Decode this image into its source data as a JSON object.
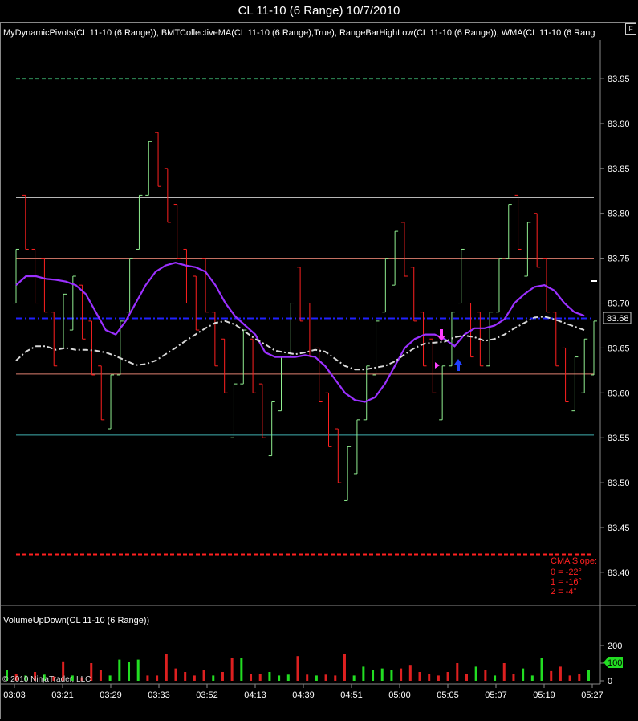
{
  "window": {
    "title": "CL 11-10 (6 Range)  10/7/2010",
    "float_button": "F"
  },
  "price_panel": {
    "label": "MyDynamicPivots(CL 11-10 (6 Range)), BMTCollectiveMA(CL 11-10 (6 Range),True), RangeBarHighLow(CL 11-10 (6 Range)), WMA(CL 11-10 (6 Rang",
    "y_ticks": [
      "83.95",
      "83.90",
      "83.85",
      "83.80",
      "83.75",
      "83.70",
      "83.65",
      "83.60",
      "83.55",
      "83.50",
      "83.45",
      "83.40"
    ],
    "last_price_label": "83.68",
    "cma_slope": {
      "title": "CMA Slope:",
      "lines": [
        "0 = -22°",
        "1 = -16°",
        "2 = -4°"
      ]
    }
  },
  "volume_panel": {
    "label": "VolumeUpDown(CL 11-10 (6 Range))",
    "y_ticks": [
      "200",
      "100",
      "0"
    ],
    "last_volume_label": "100"
  },
  "x_ticks": [
    "03:03",
    "03:21",
    "03:29",
    "03:33",
    "03:52",
    "04:13",
    "04:39",
    "04:51",
    "05:00",
    "05:05",
    "05:07",
    "05:19",
    "05:27"
  ],
  "copyright": "© 2010 NinjaTrader, LLC",
  "colors": {
    "up": "#90ee90",
    "down": "#ff2020",
    "wma": "#9b30ff",
    "cma": "#d8d8d8",
    "pivot_mid": "#2020ff",
    "volume_up": "#22dd22",
    "volume_down": "#dd2020"
  },
  "chart_data": {
    "type": "bar",
    "ohlc_bars": [
      {
        "hi": 83.76,
        "lo": 83.7,
        "o": 83.7,
        "c": 83.76
      },
      {
        "hi": 83.82,
        "lo": 83.76,
        "o": 83.82,
        "c": 83.76
      },
      {
        "hi": 83.76,
        "lo": 83.7,
        "o": 83.76,
        "c": 83.7
      },
      {
        "hi": 83.75,
        "lo": 83.69,
        "o": 83.75,
        "c": 83.69
      },
      {
        "hi": 83.69,
        "lo": 83.63,
        "o": 83.69,
        "c": 83.63
      },
      {
        "hi": 83.71,
        "lo": 83.65,
        "o": 83.65,
        "c": 83.71
      },
      {
        "hi": 83.73,
        "lo": 83.67,
        "o": 83.67,
        "c": 83.73
      },
      {
        "hi": 83.72,
        "lo": 83.66,
        "o": 83.72,
        "c": 83.66
      },
      {
        "hi": 83.68,
        "lo": 83.62,
        "o": 83.68,
        "c": 83.62
      },
      {
        "hi": 83.63,
        "lo": 83.57,
        "o": 83.63,
        "c": 83.57
      },
      {
        "hi": 83.62,
        "lo": 83.56,
        "o": 83.56,
        "c": 83.62
      },
      {
        "hi": 83.68,
        "lo": 83.62,
        "o": 83.62,
        "c": 83.68
      },
      {
        "hi": 83.75,
        "lo": 83.69,
        "o": 83.69,
        "c": 83.75
      },
      {
        "hi": 83.82,
        "lo": 83.76,
        "o": 83.76,
        "c": 83.82
      },
      {
        "hi": 83.88,
        "lo": 83.82,
        "o": 83.82,
        "c": 83.88
      },
      {
        "hi": 83.89,
        "lo": 83.83,
        "o": 83.89,
        "c": 83.83
      },
      {
        "hi": 83.85,
        "lo": 83.79,
        "o": 83.85,
        "c": 83.79
      },
      {
        "hi": 83.81,
        "lo": 83.75,
        "o": 83.81,
        "c": 83.75
      },
      {
        "hi": 83.76,
        "lo": 83.7,
        "o": 83.76,
        "c": 83.7
      },
      {
        "hi": 83.73,
        "lo": 83.67,
        "o": 83.73,
        "c": 83.67
      },
      {
        "hi": 83.75,
        "lo": 83.69,
        "o": 83.75,
        "c": 83.69
      },
      {
        "hi": 83.69,
        "lo": 83.63,
        "o": 83.69,
        "c": 83.63
      },
      {
        "hi": 83.66,
        "lo": 83.6,
        "o": 83.66,
        "c": 83.6
      },
      {
        "hi": 83.61,
        "lo": 83.55,
        "o": 83.55,
        "c": 83.61
      },
      {
        "hi": 83.67,
        "lo": 83.61,
        "o": 83.61,
        "c": 83.67
      },
      {
        "hi": 83.66,
        "lo": 83.6,
        "o": 83.66,
        "c": 83.6
      },
      {
        "hi": 83.61,
        "lo": 83.55,
        "o": 83.61,
        "c": 83.55
      },
      {
        "hi": 83.59,
        "lo": 83.53,
        "o": 83.53,
        "c": 83.59
      },
      {
        "hi": 83.64,
        "lo": 83.58,
        "o": 83.58,
        "c": 83.64
      },
      {
        "hi": 83.7,
        "lo": 83.64,
        "o": 83.64,
        "c": 83.7
      },
      {
        "hi": 83.74,
        "lo": 83.68,
        "o": 83.74,
        "c": 83.68
      },
      {
        "hi": 83.7,
        "lo": 83.64,
        "o": 83.7,
        "c": 83.64
      },
      {
        "hi": 83.65,
        "lo": 83.59,
        "o": 83.65,
        "c": 83.59
      },
      {
        "hi": 83.6,
        "lo": 83.54,
        "o": 83.6,
        "c": 83.54
      },
      {
        "hi": 83.56,
        "lo": 83.5,
        "o": 83.56,
        "c": 83.5
      },
      {
        "hi": 83.54,
        "lo": 83.48,
        "o": 83.48,
        "c": 83.54
      },
      {
        "hi": 83.57,
        "lo": 83.51,
        "o": 83.51,
        "c": 83.57
      },
      {
        "hi": 83.63,
        "lo": 83.57,
        "o": 83.57,
        "c": 83.63
      },
      {
        "hi": 83.68,
        "lo": 83.62,
        "o": 83.62,
        "c": 83.68
      },
      {
        "hi": 83.75,
        "lo": 83.69,
        "o": 83.69,
        "c": 83.75
      },
      {
        "hi": 83.78,
        "lo": 83.72,
        "o": 83.72,
        "c": 83.78
      },
      {
        "hi": 83.79,
        "lo": 83.73,
        "o": 83.79,
        "c": 83.73
      },
      {
        "hi": 83.74,
        "lo": 83.68,
        "o": 83.74,
        "c": 83.68
      },
      {
        "hi": 83.69,
        "lo": 83.63,
        "o": 83.69,
        "c": 83.63
      },
      {
        "hi": 83.66,
        "lo": 83.6,
        "o": 83.66,
        "c": 83.6
      },
      {
        "hi": 83.63,
        "lo": 83.57,
        "o": 83.57,
        "c": 83.63
      },
      {
        "hi": 83.69,
        "lo": 83.63,
        "o": 83.63,
        "c": 83.69
      },
      {
        "hi": 83.76,
        "lo": 83.7,
        "o": 83.7,
        "c": 83.76
      },
      {
        "hi": 83.7,
        "lo": 83.64,
        "o": 83.7,
        "c": 83.64
      },
      {
        "hi": 83.69,
        "lo": 83.63,
        "o": 83.69,
        "c": 83.63
      },
      {
        "hi": 83.69,
        "lo": 83.63,
        "o": 83.63,
        "c": 83.69
      },
      {
        "hi": 83.75,
        "lo": 83.69,
        "o": 83.69,
        "c": 83.75
      },
      {
        "hi": 83.81,
        "lo": 83.75,
        "o": 83.75,
        "c": 83.81
      },
      {
        "hi": 83.82,
        "lo": 83.76,
        "o": 83.82,
        "c": 83.76
      },
      {
        "hi": 83.79,
        "lo": 83.73,
        "o": 83.73,
        "c": 83.79
      },
      {
        "hi": 83.8,
        "lo": 83.74,
        "o": 83.8,
        "c": 83.74
      },
      {
        "hi": 83.75,
        "lo": 83.69,
        "o": 83.75,
        "c": 83.69
      },
      {
        "hi": 83.69,
        "lo": 83.63,
        "o": 83.69,
        "c": 83.63
      },
      {
        "hi": 83.65,
        "lo": 83.59,
        "o": 83.65,
        "c": 83.59
      },
      {
        "hi": 83.64,
        "lo": 83.58,
        "o": 83.58,
        "c": 83.64
      },
      {
        "hi": 83.66,
        "lo": 83.6,
        "o": 83.6,
        "c": 83.66
      },
      {
        "hi": 83.68,
        "lo": 83.62,
        "o": 83.62,
        "c": 83.68
      }
    ],
    "pivot_levels": [
      {
        "value": 83.95,
        "style": "dash",
        "color": "#2e8b57"
      },
      {
        "value": 83.818,
        "style": "solid",
        "color": "#d0d0d0"
      },
      {
        "value": 83.75,
        "style": "solid",
        "color": "#e08070"
      },
      {
        "value": 83.683,
        "style": "dashdot",
        "color": "#2020ff"
      },
      {
        "value": 83.621,
        "style": "solid",
        "color": "#e08070"
      },
      {
        "value": 83.553,
        "style": "solid",
        "color": "#40b0b0"
      },
      {
        "value": 83.42,
        "style": "dash",
        "color": "#ff2020"
      }
    ],
    "wma": [
      83.72,
      83.73,
      83.73,
      83.727,
      83.726,
      83.724,
      83.72,
      83.71,
      83.69,
      83.67,
      83.665,
      83.68,
      83.7,
      83.72,
      83.735,
      83.742,
      83.745,
      83.742,
      83.74,
      83.735,
      83.72,
      83.7,
      83.685,
      83.675,
      83.665,
      83.645,
      83.64,
      83.64,
      83.64,
      83.642,
      83.64,
      83.63,
      83.615,
      83.6,
      83.592,
      83.59,
      83.595,
      83.61,
      83.63,
      83.65,
      83.66,
      83.665,
      83.665,
      83.66,
      83.652,
      83.665,
      83.672,
      83.672,
      83.675,
      83.682,
      83.7,
      83.71,
      83.718,
      83.72,
      83.714,
      83.7,
      83.69,
      83.686
    ],
    "cma": [
      83.636,
      83.646,
      83.652,
      83.652,
      83.648,
      83.65,
      83.648,
      83.648,
      83.647,
      83.645,
      83.641,
      83.636,
      83.631,
      83.632,
      83.636,
      83.643,
      83.65,
      83.658,
      83.665,
      83.672,
      83.678,
      83.68,
      83.676,
      83.668,
      83.66,
      83.654,
      83.647,
      83.645,
      83.643,
      83.645,
      83.648,
      83.646,
      83.638,
      83.63,
      83.626,
      83.626,
      83.628,
      83.63,
      83.635,
      83.643,
      83.65,
      83.655,
      83.656,
      83.657,
      83.662,
      83.664,
      83.662,
      83.658,
      83.66,
      83.665,
      83.672,
      83.678,
      83.684,
      83.685,
      83.682,
      83.678,
      83.674,
      83.67
    ],
    "volume": [
      {
        "v": 60,
        "up": true
      },
      {
        "v": 40,
        "up": false
      },
      {
        "v": 30,
        "up": true
      },
      {
        "v": 50,
        "up": false
      },
      {
        "v": 35,
        "up": true
      },
      {
        "v": 25,
        "up": false
      },
      {
        "v": 110,
        "up": false
      },
      {
        "v": 30,
        "up": true
      },
      {
        "v": 20,
        "up": false
      },
      {
        "v": 100,
        "up": false
      },
      {
        "v": 60,
        "up": false
      },
      {
        "v": 30,
        "up": true
      },
      {
        "v": 120,
        "up": true
      },
      {
        "v": 105,
        "up": true
      },
      {
        "v": 120,
        "up": true
      },
      {
        "v": 30,
        "up": false
      },
      {
        "v": 30,
        "up": false
      },
      {
        "v": 150,
        "up": false
      },
      {
        "v": 70,
        "up": false
      },
      {
        "v": 50,
        "up": false
      },
      {
        "v": 30,
        "up": false
      },
      {
        "v": 60,
        "up": false
      },
      {
        "v": 30,
        "up": true
      },
      {
        "v": 50,
        "up": false
      },
      {
        "v": 130,
        "up": false
      },
      {
        "v": 130,
        "up": true
      },
      {
        "v": 40,
        "up": false
      },
      {
        "v": 40,
        "up": false
      },
      {
        "v": 50,
        "up": true
      },
      {
        "v": 30,
        "up": true
      },
      {
        "v": 35,
        "up": true
      },
      {
        "v": 140,
        "up": false
      },
      {
        "v": 35,
        "up": false
      },
      {
        "v": 30,
        "up": true
      },
      {
        "v": 35,
        "up": false
      },
      {
        "v": 30,
        "up": false
      },
      {
        "v": 150,
        "up": false
      },
      {
        "v": 30,
        "up": true
      },
      {
        "v": 80,
        "up": true
      },
      {
        "v": 60,
        "up": true
      },
      {
        "v": 70,
        "up": true
      },
      {
        "v": 60,
        "up": true
      },
      {
        "v": 70,
        "up": false
      },
      {
        "v": 90,
        "up": false
      },
      {
        "v": 50,
        "up": false
      },
      {
        "v": 40,
        "up": false
      },
      {
        "v": 30,
        "up": false
      },
      {
        "v": 50,
        "up": false
      },
      {
        "v": 100,
        "up": false
      },
      {
        "v": 40,
        "up": false
      },
      {
        "v": 80,
        "up": true
      },
      {
        "v": 60,
        "up": false
      },
      {
        "v": 30,
        "up": true
      },
      {
        "v": 100,
        "up": false
      },
      {
        "v": 40,
        "up": false
      },
      {
        "v": 70,
        "up": true
      },
      {
        "v": 30,
        "up": true
      },
      {
        "v": 130,
        "up": true
      },
      {
        "v": 55,
        "up": false
      },
      {
        "v": 80,
        "up": false
      },
      {
        "v": 30,
        "up": false
      },
      {
        "v": 40,
        "up": false
      },
      {
        "v": 60,
        "up": true
      }
    ],
    "y_range": [
      83.365,
      83.993
    ],
    "volume_range": [
      0,
      300
    ]
  }
}
